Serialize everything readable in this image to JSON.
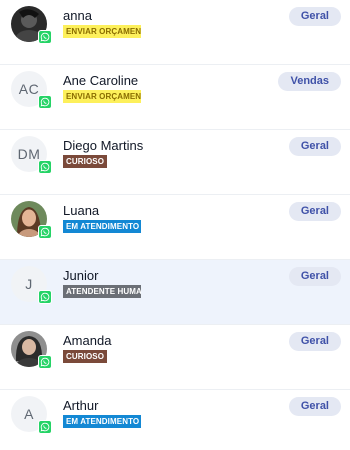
{
  "contacts": [
    {
      "name": "anna",
      "initials": "",
      "avatar": "photo-dark",
      "status": "ENVIAR ORÇAMENTO",
      "status_kind": "enviar",
      "tag": "Geral",
      "channel_icon": "whatsapp-icon"
    },
    {
      "name": "Ane Caroline",
      "initials": "AC",
      "avatar": "initials",
      "status": "ENVIAR ORÇAMENTO",
      "status_kind": "enviar",
      "tag": "Vendas",
      "channel_icon": "whatsapp-icon"
    },
    {
      "name": "Diego Martins",
      "initials": "DM",
      "avatar": "initials",
      "status": "CURIOSO",
      "status_kind": "curioso",
      "tag": "Geral",
      "channel_icon": "whatsapp-icon"
    },
    {
      "name": "Luana",
      "initials": "",
      "avatar": "photo-woman",
      "status": "EM ATENDIMENTO",
      "status_kind": "atendimento",
      "tag": "Geral",
      "channel_icon": "whatsapp-icon"
    },
    {
      "name": "Junior",
      "initials": "J",
      "avatar": "initials",
      "status": "ATENDENTE HUMANO",
      "status_kind": "humano",
      "tag": "Geral",
      "channel_icon": "whatsapp-icon",
      "selected": true
    },
    {
      "name": "Amanda",
      "initials": "",
      "avatar": "photo-woman-2",
      "status": "CURIOSO",
      "status_kind": "curioso",
      "tag": "Geral",
      "channel_icon": "whatsapp-icon"
    },
    {
      "name": "Arthur",
      "initials": "A",
      "avatar": "initials",
      "status": "EM ATENDIMENTO",
      "status_kind": "atendimento",
      "tag": "Geral",
      "channel_icon": "whatsapp-icon"
    }
  ],
  "colors": {
    "selected_row": "#eef3fc",
    "tag_bg": "#e4e8f3",
    "tag_text": "#3f51a8",
    "whatsapp": "#25d366"
  }
}
